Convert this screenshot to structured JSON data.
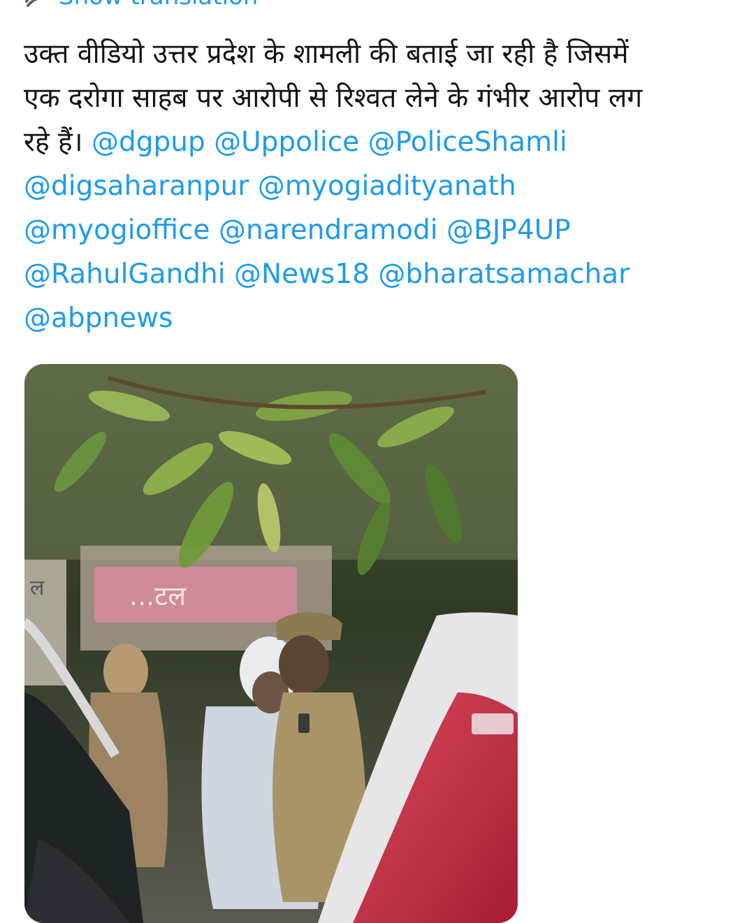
{
  "translate": {
    "label": "Show translation",
    "icon": "globe-translate-icon"
  },
  "tweet": {
    "line1": "उक्त वीडियो उत्तर प्रदेश के शामली की बताई जा रही है जिसमें",
    "line2": "एक दरोगा साहब पर आरोपी से रिश्वत लेने के गंभीर आरोप लग",
    "line3_text": "रहे हैं।",
    "mentions": [
      "@dgpup",
      "@Uppolice",
      "@PoliceShamli",
      "@digsaharanpur",
      "@myogiadityanath",
      "@myogioffice",
      "@narendramodi",
      "@BJP4UP",
      "@RahulGandhi",
      "@News18",
      "@bharatsamachar",
      "@abpnews"
    ]
  },
  "media": {
    "type": "video-thumbnail",
    "sign_text": "...टल",
    "side_sign_text": "ल"
  },
  "colors": {
    "link": "#1d9bf0",
    "text": "#0f1419",
    "background": "#ffffff"
  }
}
